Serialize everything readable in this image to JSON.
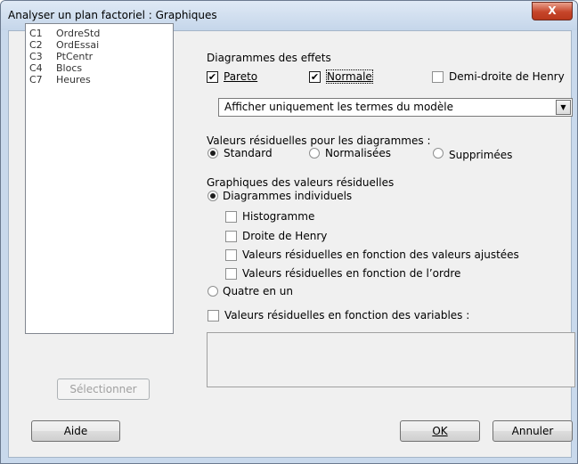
{
  "window": {
    "title": "Analyser un plan factoriel : Graphiques",
    "close_label": "X"
  },
  "variables": [
    {
      "col": "C1",
      "name": "OrdreStd"
    },
    {
      "col": "C2",
      "name": "OrdEssai"
    },
    {
      "col": "C3",
      "name": "PtCentr"
    },
    {
      "col": "C4",
      "name": "Blocs"
    },
    {
      "col": "C7",
      "name": "Heures"
    }
  ],
  "select_button": "Sélectionner",
  "effects": {
    "heading": "Diagrammes des effets",
    "pareto": {
      "label": "Pareto",
      "checked": true
    },
    "normale": {
      "label": "Normale",
      "checked": true
    },
    "henry": {
      "label": "Demi-droite de Henry",
      "checked": false
    },
    "terms_select": "Afficher uniquement les termes du modèle"
  },
  "residual_type": {
    "heading": "Valeurs résiduelles pour les diagrammes :",
    "options": [
      "Standard",
      "Normalisées",
      "Supprimées"
    ],
    "selected": "Standard"
  },
  "residual_plots": {
    "heading": "Graphiques des valeurs résiduelles",
    "individual": "Diagrammes individuels",
    "items": [
      "Histogramme",
      "Droite de Henry",
      "Valeurs résiduelles en fonction des valeurs ajustées",
      "Valeurs résiduelles en fonction de l’ordre"
    ],
    "four_in_one": "Quatre en un",
    "vs_variables": "Valeurs résiduelles en fonction des variables :"
  },
  "buttons": {
    "help": "Aide",
    "ok": "OK",
    "cancel": "Annuler"
  }
}
